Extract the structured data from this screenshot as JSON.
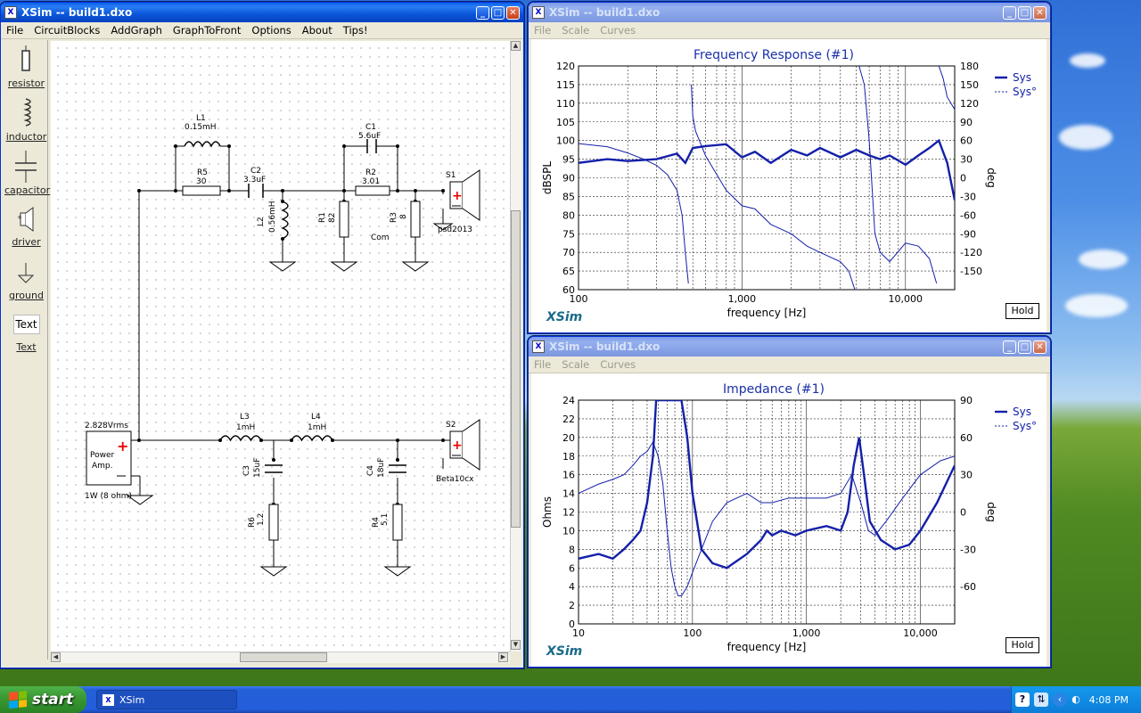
{
  "main_window": {
    "title": "XSim -- build1.dxo",
    "menu": [
      "File",
      "CircuitBlocks",
      "AddGraph",
      "GraphToFront",
      "Options",
      "About",
      "Tips!"
    ]
  },
  "palette": [
    {
      "label": "resistor",
      "icon": "resistor-icon"
    },
    {
      "label": "inductor",
      "icon": "inductor-icon"
    },
    {
      "label": "capacitor",
      "icon": "capacitor-icon"
    },
    {
      "label": "driver",
      "icon": "driver-icon"
    },
    {
      "label": "ground",
      "icon": "ground-icon"
    },
    {
      "label": "Text",
      "icon": "text-icon",
      "box": "Text"
    }
  ],
  "circuit": {
    "source": {
      "voltage": "2.828Vrms",
      "name1": "Power",
      "name2": "Amp.",
      "power": "1W (8 ohm)"
    },
    "components": {
      "L1": {
        "name": "L1",
        "value": "0.15mH"
      },
      "R5": {
        "name": "R5",
        "value": "30"
      },
      "C2": {
        "name": "C2",
        "value": "3.3uF"
      },
      "L2": {
        "name": "L2",
        "value": "0.56mH"
      },
      "C1": {
        "name": "C1",
        "value": "5.6uF"
      },
      "R2": {
        "name": "R2",
        "value": "3.01"
      },
      "R1": {
        "name": "R1",
        "value": "82"
      },
      "R3": {
        "name": "R3",
        "value": "8"
      },
      "com": "Com",
      "S1": {
        "name": "S1",
        "model": "psd2013"
      },
      "L3": {
        "name": "L3",
        "value": "1mH"
      },
      "L4": {
        "name": "L4",
        "value": "1mH"
      },
      "C3": {
        "name": "C3",
        "value": "15uF"
      },
      "C4": {
        "name": "C4",
        "value": "18uF"
      },
      "R6": {
        "name": "R6",
        "value": "1.2"
      },
      "R4": {
        "name": "R4",
        "value": "5.1"
      },
      "S2": {
        "name": "S2",
        "model": "Beta10cx"
      }
    }
  },
  "graph_menu": [
    "File",
    "Scale",
    "Curves"
  ],
  "freq_window": {
    "title": "XSim -- build1.dxo",
    "hold": "Hold",
    "brand": "XSim",
    "chart_data": {
      "type": "line",
      "title": "Frequency Response (#1)",
      "xlabel": "frequency [Hz]",
      "ylabel": "dBSPL",
      "y2label": "deg",
      "xscale": "log",
      "xlim": [
        100,
        20000
      ],
      "ylim": [
        60,
        120
      ],
      "y2lim": [
        -180,
        180
      ],
      "xticks": [
        "100",
        "1,000",
        "10,000"
      ],
      "yticks": [
        "120",
        "115",
        "110",
        "105",
        "100",
        "95",
        "90",
        "85",
        "80",
        "75",
        "70",
        "65",
        "60"
      ],
      "y2ticks": [
        "180",
        "150",
        "120",
        "90",
        "60",
        "30",
        "0",
        "-30",
        "-60",
        "-90",
        "-120",
        "-150"
      ],
      "legend": [
        "Sys",
        "Sys°"
      ],
      "legend_position": "top-right",
      "grid": true,
      "series": [
        {
          "name": "Sys",
          "axis": "left",
          "x": [
            100,
            150,
            200,
            300,
            400,
            450,
            500,
            600,
            800,
            1000,
            1200,
            1500,
            2000,
            2500,
            3000,
            4000,
            5000,
            6000,
            7000,
            8000,
            10000,
            12000,
            14000,
            16000,
            18000,
            20000
          ],
          "y": [
            94,
            95,
            94.5,
            95,
            96.5,
            94,
            98,
            98.5,
            99,
            95.5,
            97,
            94,
            97.5,
            96,
            98,
            95.5,
            97.5,
            96,
            95,
            96,
            93.5,
            96,
            98,
            100,
            94,
            84
          ]
        },
        {
          "name": "Sys°",
          "axis": "right",
          "x": [
            100,
            150,
            200,
            250,
            300,
            350,
            400,
            430,
            450,
            470,
            490,
            500,
            520,
            600,
            800,
            1000,
            1200,
            1500,
            2000,
            2500,
            3000,
            4000,
            4500,
            4900,
            5200,
            5600,
            6000,
            6500,
            7000,
            8000,
            10000,
            12000,
            14000,
            15500,
            16000,
            17000,
            18000,
            20000
          ],
          "y": [
            55,
            50,
            40,
            30,
            20,
            5,
            -20,
            -60,
            -120,
            -170,
            150,
            100,
            75,
            35,
            -20,
            -45,
            -50,
            -75,
            -90,
            -110,
            -120,
            -135,
            -150,
            -180,
            180,
            150,
            60,
            -90,
            -120,
            -135,
            -105,
            -110,
            -130,
            -170,
            180,
            160,
            130,
            110
          ]
        }
      ]
    }
  },
  "imp_window": {
    "title": "XSim -- build1.dxo",
    "hold": "Hold",
    "brand": "XSim",
    "chart_data": {
      "type": "line",
      "title": "Impedance (#1)",
      "xlabel": "frequency [Hz]",
      "ylabel": "Ohms",
      "y2label": "deg",
      "xscale": "log",
      "xlim": [
        10,
        20000
      ],
      "ylim": [
        0,
        24
      ],
      "y2lim": [
        -90,
        90
      ],
      "xticks": [
        "10",
        "100",
        "1,000",
        "10,000"
      ],
      "yticks": [
        "24",
        "22",
        "20",
        "18",
        "16",
        "14",
        "12",
        "10",
        "8",
        "6",
        "4",
        "2",
        "0"
      ],
      "y2ticks": [
        "90",
        "60",
        "30",
        "0",
        "-30",
        "-60"
      ],
      "legend": [
        "Sys",
        "Sys°"
      ],
      "legend_position": "top-right",
      "grid": true,
      "series": [
        {
          "name": "Sys",
          "axis": "left",
          "x": [
            10,
            15,
            20,
            25,
            30,
            35,
            40,
            45,
            48,
            50,
            55,
            60,
            65,
            70,
            80,
            90,
            100,
            120,
            150,
            200,
            300,
            400,
            450,
            500,
            600,
            800,
            1000,
            1500,
            2000,
            2300,
            2600,
            2900,
            3200,
            3600,
            4500,
            6000,
            8000,
            10000,
            14000,
            20000
          ],
          "y": [
            7,
            7.5,
            7,
            8,
            9,
            10,
            13,
            18,
            24,
            24,
            24,
            24,
            24,
            24,
            24,
            20,
            14,
            8,
            6.5,
            6,
            7.5,
            9,
            10,
            9.5,
            10,
            9.5,
            10,
            10.5,
            10,
            12,
            17,
            20,
            16,
            11,
            9,
            8,
            8.5,
            10,
            13,
            17
          ]
        },
        {
          "name": "Sys°",
          "axis": "left",
          "x": [
            10,
            15,
            20,
            25,
            30,
            35,
            40,
            45,
            50,
            55,
            60,
            65,
            70,
            75,
            80,
            90,
            100,
            120,
            150,
            200,
            300,
            400,
            500,
            700,
            1000,
            1500,
            2000,
            2500,
            3000,
            3500,
            4000,
            5000,
            7000,
            10000,
            15000,
            20000
          ],
          "y": [
            14,
            15,
            15.5,
            16,
            17,
            18,
            18.5,
            19.5,
            18,
            15,
            10,
            6,
            4,
            3,
            3,
            4,
            5.5,
            8,
            11,
            13,
            14,
            13,
            13,
            13.5,
            13.5,
            13.5,
            14,
            16,
            13,
            10,
            9.5,
            11,
            13.5,
            16,
            17.5,
            18
          ]
        }
      ]
    }
  },
  "taskbar": {
    "start": "start",
    "task": "XSim",
    "time": "4:08 PM",
    "help": "?"
  }
}
